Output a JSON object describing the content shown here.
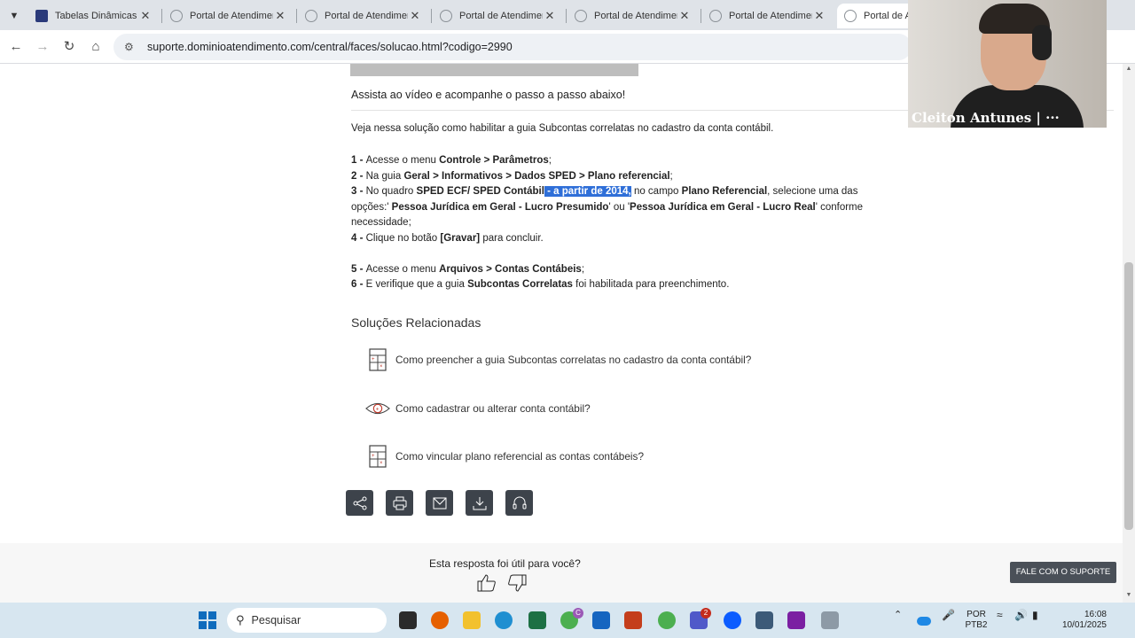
{
  "browser": {
    "tabs": [
      {
        "label": "Tabelas Dinâmicas e",
        "favicon_color": "#2a3a7a"
      },
      {
        "label": "Portal de Atendimen",
        "favicon_color": "#b0b6bd"
      },
      {
        "label": "Portal de Atendimen",
        "favicon_color": "#b0b6bd"
      },
      {
        "label": "Portal de Atendimen",
        "favicon_color": "#b0b6bd"
      },
      {
        "label": "Portal de Atendimen",
        "favicon_color": "#b0b6bd"
      },
      {
        "label": "Portal de Atendimen",
        "favicon_color": "#b0b6bd"
      },
      {
        "label": "Portal de At",
        "favicon_color": "#b0b6bd"
      }
    ],
    "url": "suporte.dominioatendimento.com/central/faces/solucao.html?codigo=2990"
  },
  "article": {
    "intro": "Assista ao vídeo e acompanhe o passo a passo abaixo!",
    "lead": "Veja nessa solução como habilitar a guia Subcontas correlatas no cadastro da conta contábil.",
    "step1": {
      "num": "1 - ",
      "t1": "Acesse o menu ",
      "b1": "Controle > Parâmetros",
      "t2": ";"
    },
    "step2": {
      "num": "2 - ",
      "t1": "Na guia ",
      "b1": "Geral > Informativos > Dados SPED > Plano referencial",
      "t2": ";"
    },
    "step3": {
      "num": "3 - ",
      "t1": "No quadro ",
      "b1": "SPED ECF/ SPED Contábil",
      "hl": " - a partir de 2014,",
      "t2": " no campo ",
      "b2": "Plano Referencial",
      "t3": ", selecione uma das opções:' ",
      "b3": "Pessoa Jurídica em Geral - Lucro Presumido",
      "t4": "' ou '",
      "b4": "Pessoa Jurídica em Geral - Lucro Real",
      "t5": "' conforme necessidade;"
    },
    "step4": {
      "num": "4 - ",
      "t1": "Clique no botão ",
      "b1": "[Gravar]",
      "t2": " para concluir."
    },
    "step5": {
      "num": "5 - ",
      "t1": "Acesse o menu ",
      "b1": "Arquivos > Contas Contábeis",
      "t2": ";"
    },
    "step6": {
      "num": "6 - ",
      "t1": "E verifique que a guia ",
      "b1": "Subcontas Correlatas",
      "t2": " foi habilitada para preenchimento."
    }
  },
  "related": {
    "title": "Soluções Relacionadas",
    "items": [
      {
        "label": "Como preencher a guia Subcontas correlatas no cadastro da conta contábil?",
        "icon": "calculator-icon"
      },
      {
        "label": "Como cadastrar ou alterar conta contábil?",
        "icon": "eye-icon"
      },
      {
        "label": "Como vincular plano referencial as contas contábeis?",
        "icon": "calculator-icon"
      }
    ]
  },
  "actions": [
    "share-icon",
    "print-icon",
    "mail-icon",
    "download-icon",
    "headset-icon"
  ],
  "feedback": {
    "question": "Esta resposta foi útil para você?"
  },
  "support_button": "FALE COM O SUPORTE",
  "webcam": {
    "name": "Cleiton Antunes | ···"
  },
  "taskbar": {
    "search_placeholder": "Pesquisar",
    "lang": "POR",
    "layout": "PTB2",
    "time": "16:08",
    "date": "10/01/2025",
    "badge_chrome": "C",
    "badge_teams": "2"
  },
  "colors": {
    "highlight": "#2f6fd8",
    "action_bg": "#3d434b",
    "taskbar": "#d7e6f0"
  }
}
